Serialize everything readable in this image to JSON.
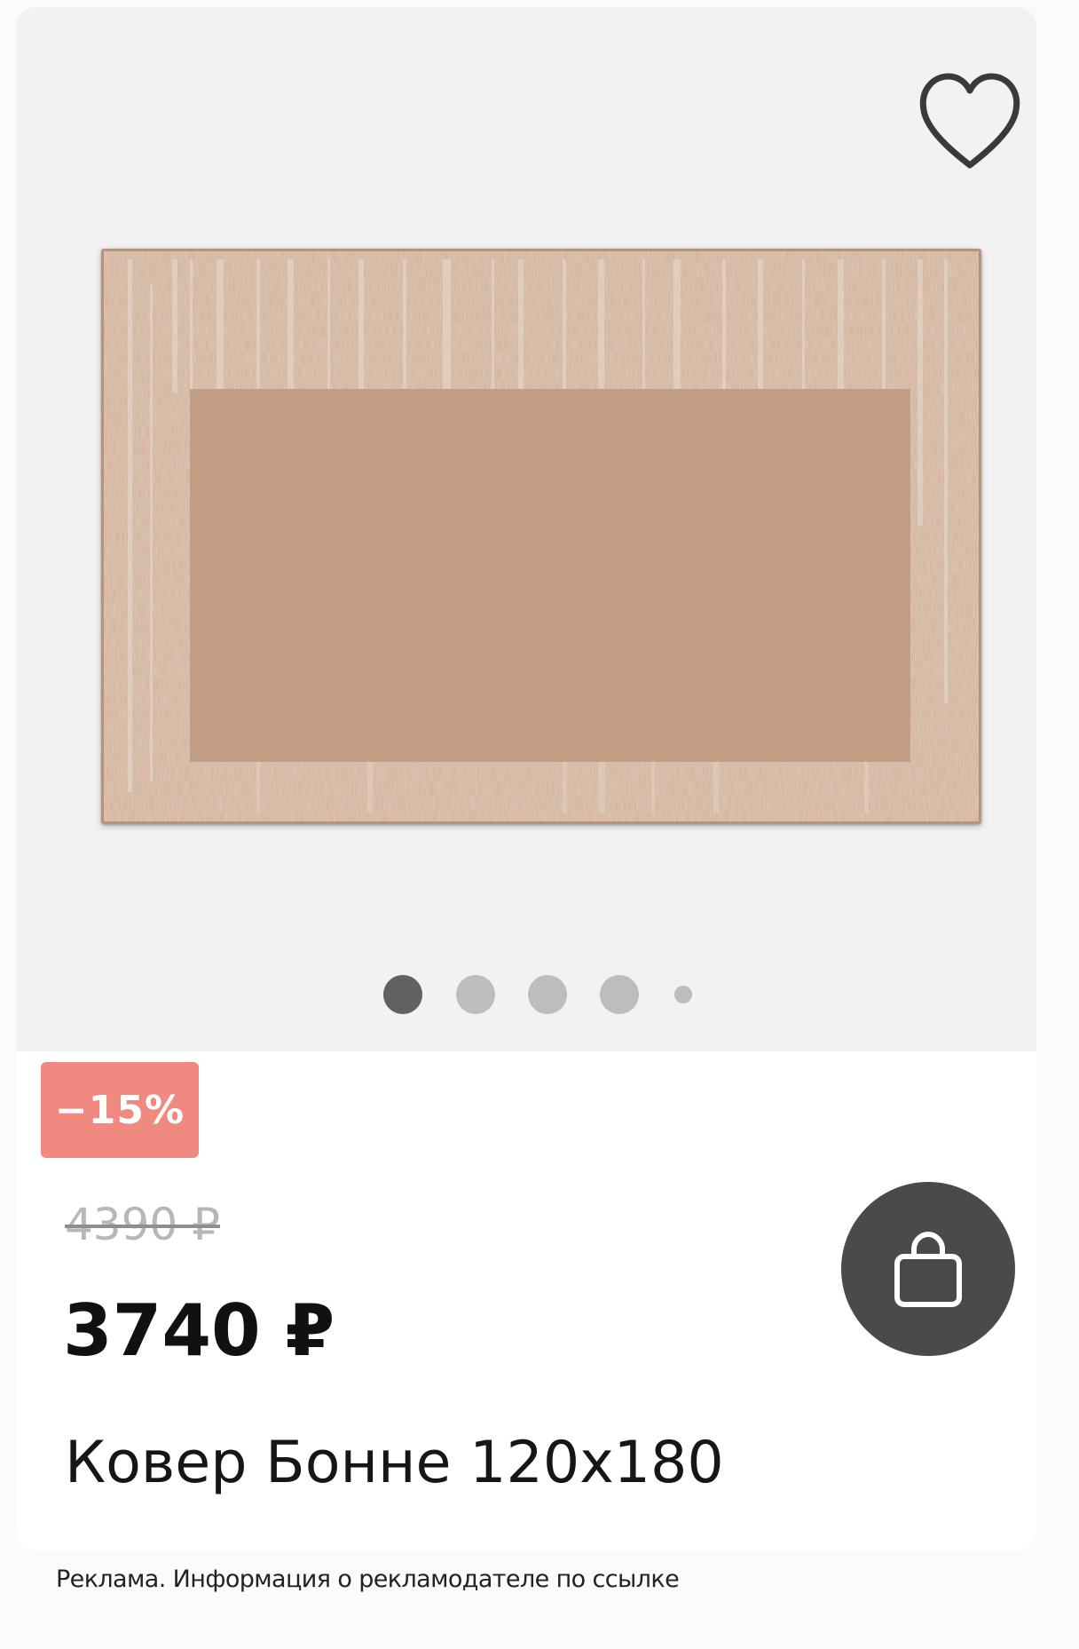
{
  "favorite": {
    "icon": "heart-outline-icon"
  },
  "gallery": {
    "image_alt": "Ковер Бонне 120x180",
    "dots_count": 5,
    "active_index": 0
  },
  "badge": {
    "text": "−15%",
    "color": "#f08a80"
  },
  "price": {
    "old": "4390 ₽",
    "current": "3740 ₽"
  },
  "cart": {
    "icon": "shopping-bag-icon",
    "color": "#4b4a4a"
  },
  "product": {
    "title": "Ковер Бонне 120х180"
  },
  "ad_note": "Реклама. Информация о рекламодателе по ссылке",
  "colors": {
    "gallery_bg": "#f2f2f2",
    "rug": "#c9a58b"
  }
}
